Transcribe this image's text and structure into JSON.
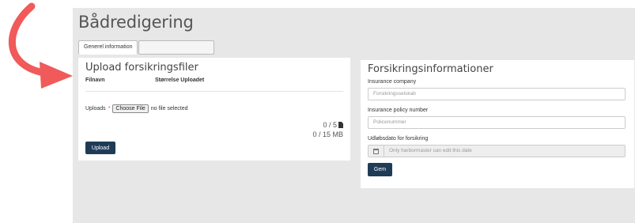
{
  "page": {
    "title": "Bådredigering",
    "tabs": [
      {
        "label": "Generel information",
        "active": true
      },
      {
        "label": "",
        "active": false
      }
    ]
  },
  "upload": {
    "heading": "Upload forsikringsfiler",
    "columns": [
      "Filnavn",
      "Størrelse Uploadet"
    ],
    "uploads_label": "Uploads",
    "required_mark": "*",
    "choose_button": "Choose File",
    "no_file_text": "no file selected",
    "file_count": "0 / 5",
    "size_count": "0 / 15 MB",
    "upload_button": "Upload"
  },
  "insurance": {
    "heading": "Forsikringsinformationer",
    "company_label": "Insurance company",
    "company_placeholder": "Forsikringsselskab",
    "policy_label": "Insurance policy number",
    "policy_placeholder": "Policenummer",
    "expiry_label": "Udløbsdato for forsikring",
    "expiry_placeholder": "Only harbormaster can edit this date",
    "save_button": "Gem"
  },
  "colors": {
    "primary": "#1f3c57",
    "arrow": "#f05a5a",
    "background": "#e7e7e7",
    "required": "#d9534f"
  },
  "icons": [
    "curved-arrow-icon",
    "file-icon",
    "calendar-icon"
  ]
}
